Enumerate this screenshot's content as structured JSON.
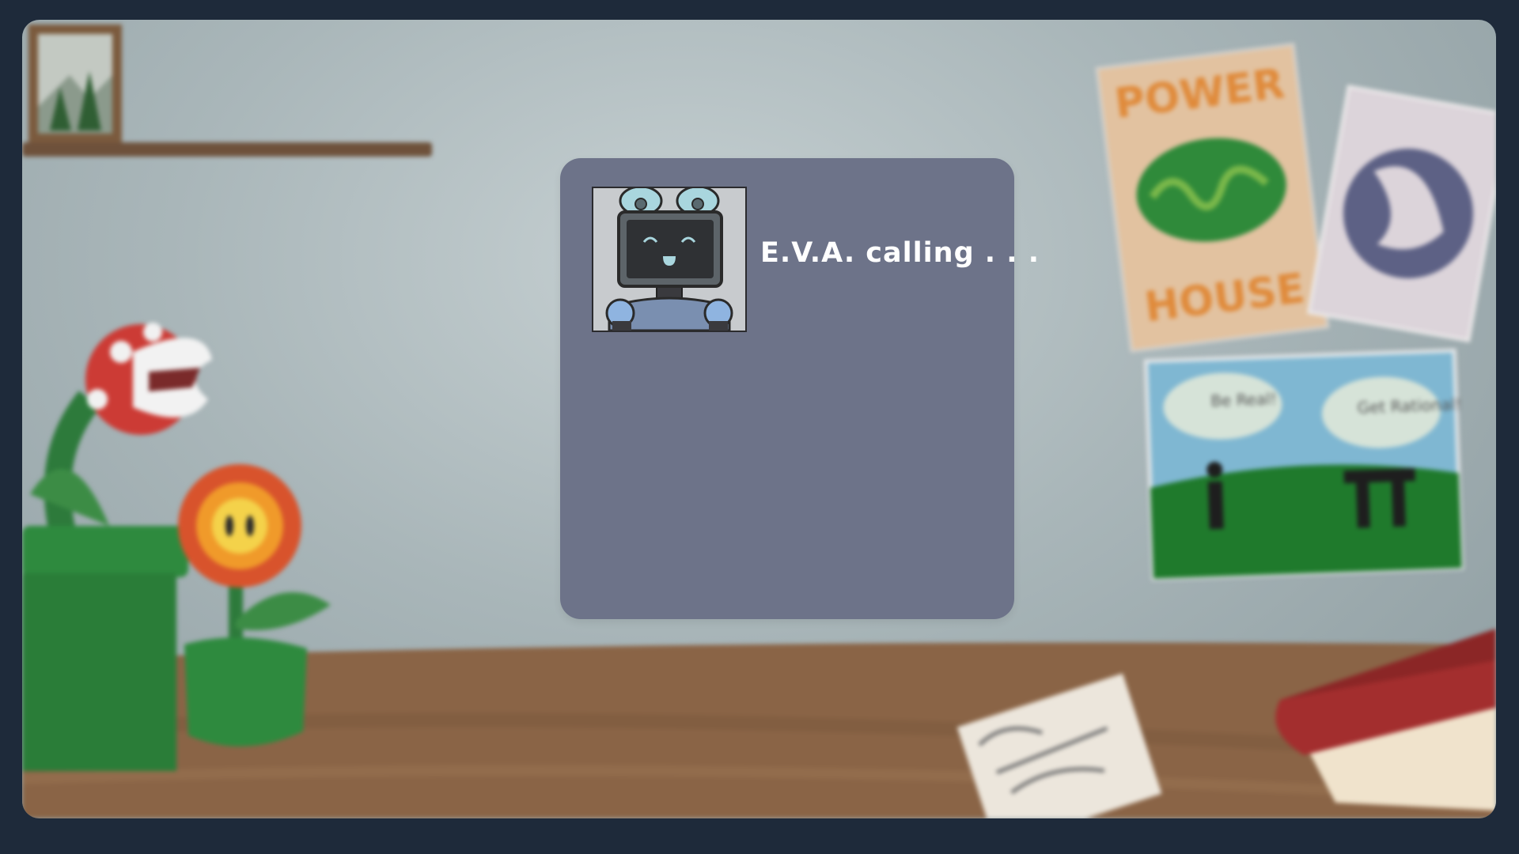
{
  "game": {
    "call_dialog": {
      "caller_text": "E.V.A. calling . . .",
      "caller_avatar": "robot-monitor-face-avatar"
    },
    "background": {
      "objects": [
        "framed-tree-picture",
        "wall-shelf",
        "piranha-plant-pipe",
        "fire-flower-pot",
        "powerhouse-poster",
        "moon-poster",
        "i-and-pi-poster",
        "wooden-desk",
        "paper-sheet",
        "red-book"
      ],
      "poster_powerhouse": {
        "line1": "POWER",
        "line2": "HOUSE"
      },
      "poster_comic": {
        "bubble_left": "Be Real!",
        "bubble_right": "Get Rational!"
      }
    },
    "colors": {
      "panel": "#6d7389",
      "frame": "#1e2a3a",
      "wall": "#a9b6b9",
      "desk": "#8a6446"
    }
  }
}
